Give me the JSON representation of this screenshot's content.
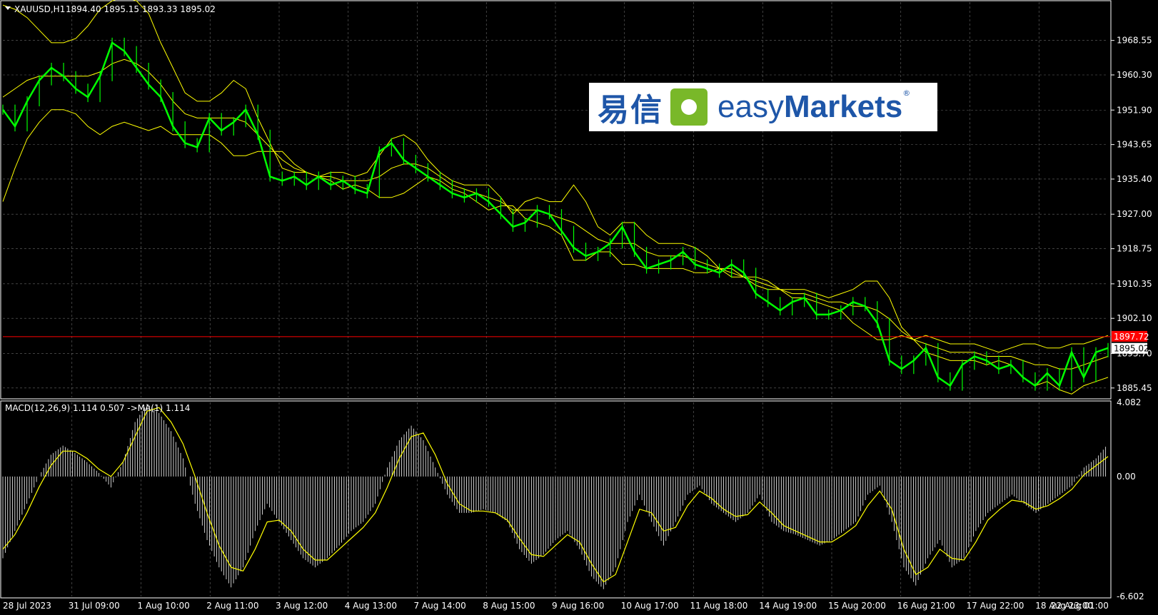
{
  "header": {
    "symbol": "XAUUSD,H1",
    "ohlc": "1894.40 1895.15 1893.33 1895.02"
  },
  "macd_header": "MACD(12,26,9) 1.114 0.507  ->MA(1) 1.114",
  "logo": {
    "cn": "易信",
    "en_light": "easy",
    "en_bold": "Markets",
    "reg": "®"
  },
  "colors": {
    "background": "#000000",
    "grid": "#c0c0c0",
    "candles": "#00ff00",
    "bands": "#ffff00",
    "macd_hist": "#ffffff",
    "signal": "#ffff00",
    "price_line": "#ff0000"
  },
  "chart_data": [
    {
      "type": "line",
      "name": "XAUUSD H1 price with Bollinger Bands",
      "x_labels": [
        "28 Jul 2023",
        "31 Jul 09:00",
        "1 Aug 10:00",
        "2 Aug 11:00",
        "3 Aug 12:00",
        "4 Aug 13:00",
        "7 Aug 14:00",
        "8 Aug 15:00",
        "9 Aug 16:00",
        "10 Aug 17:00",
        "11 Aug 18:00",
        "14 Aug 19:00",
        "15 Aug 20:00",
        "16 Aug 21:00",
        "17 Aug 22:00",
        "18 Aug 23:00",
        "22 Aug 01:00"
      ],
      "y_ticks": [
        "1968.55",
        "1960.30",
        "1951.90",
        "1943.65",
        "1935.40",
        "1927.00",
        "1918.75",
        "1910.35",
        "1902.10",
        "1893.70",
        "1885.45"
      ],
      "ylim": [
        1883.2,
        1977.7
      ],
      "price_line": "1897.72",
      "current_price": "1895.02",
      "series": [
        {
          "values": [
            1952,
            1948,
            1954,
            1959,
            1962,
            1960,
            1957,
            1955,
            1960,
            1968,
            1966,
            1962,
            1958,
            1955,
            1948,
            1944,
            1943,
            1950,
            1947,
            1949,
            1952,
            1946,
            1936,
            1935,
            1936,
            1934,
            1936,
            1934,
            1935,
            1933,
            1932,
            1942,
            1944,
            1940,
            1938,
            1936,
            1934,
            1932,
            1931,
            1932,
            1930,
            1927,
            1924,
            1925,
            1928,
            1927,
            1923,
            1919,
            1917,
            1918,
            1920,
            1924,
            1918,
            1914,
            1915,
            1916,
            1918,
            1915,
            1914,
            1913,
            1915,
            1913,
            1908,
            1906,
            1904,
            1906,
            1907,
            1903,
            1903,
            1904,
            1906,
            1905,
            1901,
            1892,
            1890,
            1892,
            1895,
            1888,
            1886,
            1891,
            1893,
            1892,
            1890,
            1891,
            1888,
            1886,
            1889,
            1886,
            1894,
            1888,
            1894,
            1895
          ]
        },
        {
          "values": [
            1977,
            1976,
            1974,
            1971,
            1968,
            1968,
            1969,
            1972,
            1976,
            1978,
            1979,
            1978,
            1975,
            1968,
            1962,
            1956,
            1954,
            1954,
            1956,
            1959,
            1957,
            1950,
            1944,
            1938,
            1937,
            1937,
            1936,
            1937,
            1937,
            1936,
            1937,
            1941,
            1945,
            1946,
            1944,
            1940,
            1937,
            1935,
            1934,
            1934,
            1934,
            1931,
            1927,
            1930,
            1931,
            1930,
            1930,
            1934,
            1930,
            1924,
            1922,
            1925,
            1925,
            1922,
            1920,
            1920,
            1920,
            1919,
            1917,
            1914,
            1914,
            1912,
            1910,
            1909,
            1909,
            1909,
            1909,
            1908,
            1907,
            1908,
            1909,
            1911,
            1911,
            1907,
            1900,
            1897,
            1898,
            1897,
            1896,
            1896,
            1896,
            1895,
            1894,
            1895,
            1896,
            1896,
            1895,
            1895,
            1896,
            1896,
            1897,
            1898
          ]
        },
        {
          "values": [
            1955,
            1957,
            1959,
            1960,
            1960,
            1960,
            1960,
            1960,
            1961,
            1963,
            1964,
            1963,
            1961,
            1958,
            1954,
            1951,
            1950,
            1950,
            1950,
            1950,
            1949,
            1946,
            1943,
            1940,
            1938,
            1937,
            1936,
            1936,
            1935,
            1935,
            1935,
            1936,
            1938,
            1939,
            1939,
            1938,
            1936,
            1934,
            1933,
            1932,
            1931,
            1930,
            1928,
            1928,
            1928,
            1927,
            1926,
            1925,
            1923,
            1921,
            1920,
            1920,
            1920,
            1918,
            1917,
            1917,
            1917,
            1916,
            1915,
            1914,
            1913,
            1912,
            1911,
            1910,
            1909,
            1908,
            1908,
            1907,
            1906,
            1906,
            1905,
            1905,
            1904,
            1902,
            1899,
            1897,
            1896,
            1895,
            1894,
            1894,
            1894,
            1893,
            1893,
            1893,
            1892,
            1891,
            1891,
            1890,
            1890,
            1891,
            1892,
            1893
          ]
        },
        {
          "values": [
            1930,
            1938,
            1945,
            1949,
            1952,
            1952,
            1951,
            1948,
            1946,
            1948,
            1949,
            1948,
            1947,
            1948,
            1946,
            1946,
            1946,
            1946,
            1944,
            1941,
            1941,
            1942,
            1942,
            1942,
            1939,
            1937,
            1936,
            1935,
            1933,
            1934,
            1933,
            1931,
            1931,
            1932,
            1934,
            1936,
            1935,
            1933,
            1932,
            1930,
            1928,
            1929,
            1929,
            1926,
            1925,
            1924,
            1922,
            1916,
            1916,
            1918,
            1918,
            1915,
            1915,
            1914,
            1914,
            1914,
            1914,
            1913,
            1913,
            1914,
            1912,
            1912,
            1912,
            1911,
            1909,
            1907,
            1907,
            1906,
            1905,
            1904,
            1901,
            1899,
            1897,
            1897,
            1898,
            1897,
            1894,
            1893,
            1892,
            1892,
            1892,
            1891,
            1892,
            1891,
            1888,
            1886,
            1887,
            1885,
            1884,
            1886,
            1887,
            1888
          ]
        }
      ]
    },
    {
      "type": "bar",
      "name": "MACD(12,26,9)",
      "y_ticks": [
        "4.082",
        "0.00",
        "-6.602"
      ],
      "ylim": [
        -6.602,
        4.082
      ],
      "series": [
        {
          "values": [
            -4.5,
            -3.0,
            -1.5,
            0.0,
            1.2,
            1.7,
            1.3,
            0.8,
            0.2,
            -0.6,
            0.8,
            3.0,
            4.0,
            3.5,
            2.5,
            1.0,
            -1.5,
            -3.5,
            -5.0,
            -6.1,
            -5.0,
            -3.0,
            -1.5,
            -2.5,
            -3.5,
            -4.5,
            -5.0,
            -4.5,
            -3.8,
            -3.0,
            -2.5,
            -1.5,
            0.5,
            2.0,
            2.8,
            2.0,
            0.5,
            -1.0,
            -2.0,
            -2.0,
            -1.8,
            -2.0,
            -2.5,
            -4.0,
            -4.8,
            -4.3,
            -3.5,
            -3.0,
            -4.0,
            -5.5,
            -6.2,
            -5.0,
            -2.5,
            -1.0,
            -2.5,
            -3.8,
            -2.5,
            -1.0,
            -0.5,
            -1.5,
            -2.0,
            -2.5,
            -2.0,
            -1.0,
            -2.5,
            -3.0,
            -3.2,
            -3.5,
            -3.8,
            -3.5,
            -3.0,
            -2.5,
            -1.0,
            -0.5,
            -2.5,
            -5.0,
            -6.0,
            -4.5,
            -3.5,
            -5.0,
            -4.5,
            -3.0,
            -2.0,
            -1.5,
            -1.0,
            -1.5,
            -2.0,
            -1.5,
            -1.0,
            -0.5,
            0.5,
            1.0,
            1.8
          ]
        },
        {
          "values": [
            -4.0,
            -3.2,
            -2.0,
            -0.6,
            0.6,
            1.4,
            1.4,
            1.0,
            0.4,
            0.0,
            0.8,
            2.2,
            3.6,
            3.8,
            3.0,
            1.8,
            0.0,
            -2.0,
            -3.8,
            -5.0,
            -5.2,
            -4.0,
            -2.5,
            -2.4,
            -3.0,
            -4.0,
            -4.6,
            -4.6,
            -4.0,
            -3.4,
            -2.8,
            -2.0,
            -0.6,
            1.0,
            2.2,
            2.4,
            1.2,
            -0.4,
            -1.5,
            -1.9,
            -1.9,
            -2.0,
            -2.4,
            -3.4,
            -4.3,
            -4.4,
            -3.8,
            -3.2,
            -3.6,
            -4.8,
            -5.8,
            -5.4,
            -3.6,
            -1.8,
            -2.0,
            -3.0,
            -2.8,
            -1.6,
            -0.8,
            -1.2,
            -1.8,
            -2.2,
            -2.1,
            -1.4,
            -2.0,
            -2.7,
            -3.0,
            -3.3,
            -3.6,
            -3.6,
            -3.2,
            -2.7,
            -1.6,
            -0.8,
            -1.8,
            -4.0,
            -5.4,
            -5.0,
            -4.0,
            -4.5,
            -4.6,
            -3.6,
            -2.4,
            -1.8,
            -1.3,
            -1.4,
            -1.8,
            -1.6,
            -1.2,
            -0.7,
            0.1,
            0.6,
            1.1
          ]
        }
      ]
    }
  ]
}
